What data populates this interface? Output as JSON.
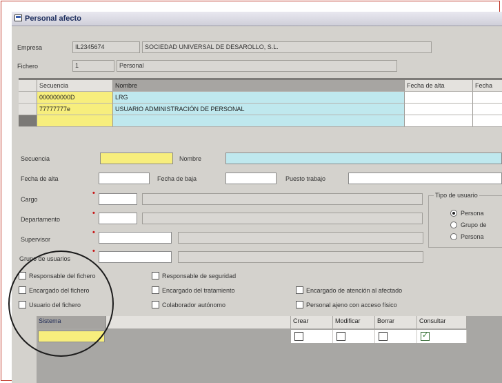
{
  "window": {
    "title": "Personal afecto"
  },
  "header": {
    "empresa_label": "Empresa",
    "empresa_code": "IL2345674",
    "empresa_name": "SOCIEDAD UNIVERSAL DE DESAROLLO, S.L.",
    "fichero_label": "Fichero",
    "fichero_code": "1",
    "fichero_name": "Personal"
  },
  "grid1": {
    "columns": [
      "Secuencia",
      "Nombre",
      "Fecha de alta",
      "Fecha"
    ],
    "rows": [
      {
        "secuencia": "000000000D",
        "nombre": "LRG"
      },
      {
        "secuencia": "77777777e",
        "nombre": "USUARIO ADMINISTRACIÓN DE PERSONAL"
      },
      {
        "secuencia": "",
        "nombre": ""
      }
    ]
  },
  "form": {
    "secuencia_label": "Secuencia",
    "nombre_label": "Nombre",
    "fecha_alta_label": "Fecha de alta",
    "fecha_baja_label": "Fecha de baja",
    "puesto_label": "Puesto trabajo",
    "cargo_label": "Cargo",
    "departamento_label": "Departamento",
    "supervisor_label": "Supervisor",
    "grupo_label": "Grupo de usuarios",
    "tipo_usuario_label": "Tipo de usuario",
    "tipo_options": [
      "Persona",
      "Grupo de",
      "Persona"
    ]
  },
  "checks": {
    "resp_fichero": "Responsable del fichero",
    "resp_seguridad": "Responsable de seguridad",
    "enc_fichero": "Encargado del fichero",
    "enc_tratamiento": "Encargado del tratamiento",
    "enc_atencion": "Encargado de atención al afectado",
    "usuario_fichero": "Usuario del fichero",
    "colaborador": "Colaborador autónomo",
    "personal_ajeno": "Personal ajeno con acceso físico"
  },
  "grid2": {
    "columns": [
      "Sistema",
      "Crear",
      "Modificar",
      "Borrar",
      "Consultar"
    ],
    "consultar_checked": true
  }
}
